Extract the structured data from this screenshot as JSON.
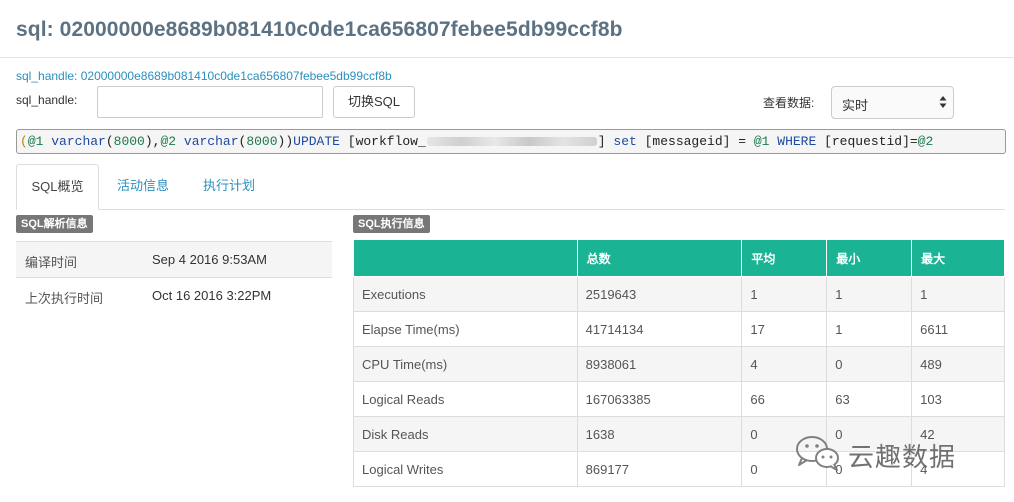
{
  "header": {
    "title": "sql: 02000000e8689b081410c0de1ca656807febee5db99ccf8b",
    "sql_handle_link": "sql_handle: 02000000e8689b081410c0de1ca656807febee5db99ccf8b"
  },
  "controls": {
    "sql_handle_label": "sql_handle:",
    "sql_handle_value": "",
    "switch_button": "切换SQL",
    "view_label": "查看数据:",
    "view_select_value": "实时"
  },
  "sql_text": {
    "part1": "(@1 varchar(8000),@2 varchar(8000))UPDATE [workflow_",
    "part2": "] set [messageid] = @1  WHERE [requestid]=@2"
  },
  "tabs": [
    {
      "label": "SQL概览",
      "active": true
    },
    {
      "label": "活动信息",
      "active": false
    },
    {
      "label": "执行计划",
      "active": false
    }
  ],
  "parse_info": {
    "badge": "SQL解析信息",
    "rows": [
      {
        "key": "编译时间",
        "value": "Sep 4 2016 9:53AM"
      },
      {
        "key": "上次执行时间",
        "value": "Oct 16 2016 3:22PM"
      }
    ]
  },
  "exec_info": {
    "badge": "SQL执行信息",
    "columns": [
      "",
      "总数",
      "平均",
      "最小",
      "最大"
    ],
    "rows": [
      {
        "name": "Executions",
        "total": "2519643",
        "avg": "1",
        "min": "1",
        "max": "1"
      },
      {
        "name": "Elapse Time(ms)",
        "total": "41714134",
        "avg": "17",
        "min": "1",
        "max": "6611"
      },
      {
        "name": "CPU Time(ms)",
        "total": "8938061",
        "avg": "4",
        "min": "0",
        "max": "489"
      },
      {
        "name": "Logical Reads",
        "total": "167063385",
        "avg": "66",
        "min": "63",
        "max": "103"
      },
      {
        "name": "Disk Reads",
        "total": "1638",
        "avg": "0",
        "min": "0",
        "max": "42"
      },
      {
        "name": "Logical Writes",
        "total": "869177",
        "avg": "0",
        "min": "0",
        "max": "4"
      }
    ]
  },
  "watermark": {
    "icon": "wechat-icon",
    "text": "云趣数据"
  }
}
